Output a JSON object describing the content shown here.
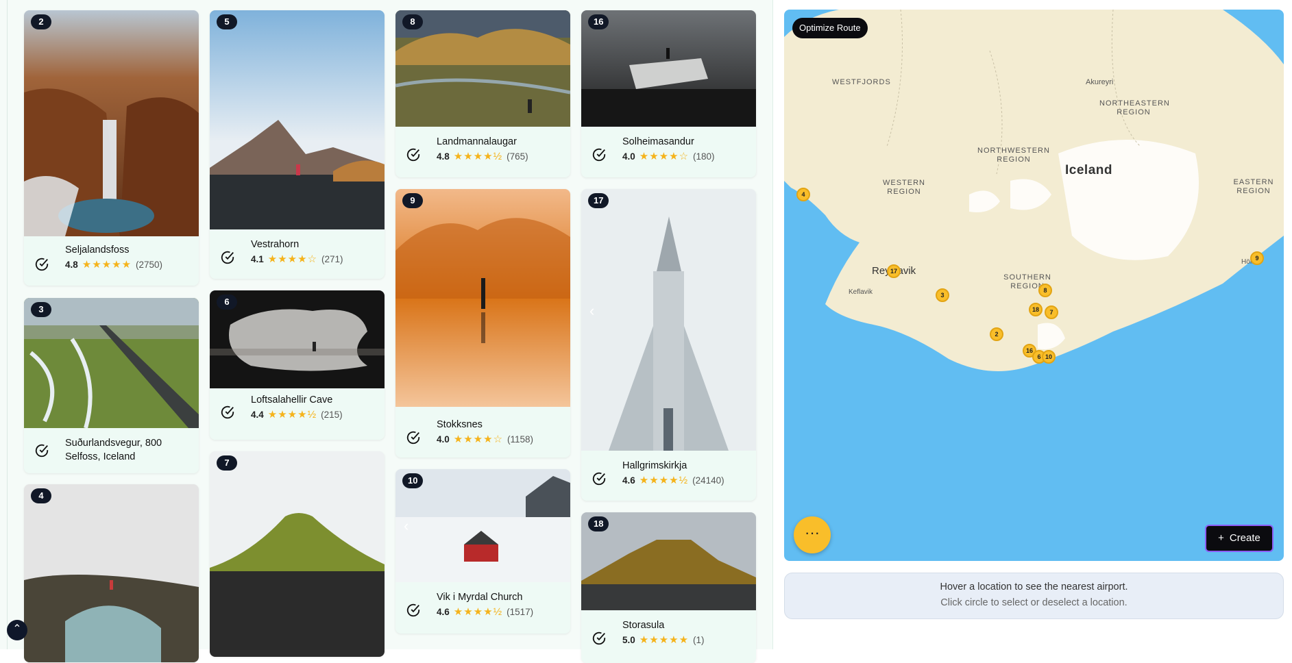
{
  "cards": [
    {
      "num": "2",
      "title": "Seljalandsfoss",
      "rating": "4.8",
      "stars": "★★★★★",
      "count": "(2750)"
    },
    {
      "num": "3",
      "title": "Suðurlandsvegur, 800 Selfoss, Iceland",
      "rating": "",
      "stars": "",
      "count": ""
    },
    {
      "num": "4",
      "title": "",
      "rating": "",
      "stars": "",
      "count": ""
    },
    {
      "num": "5",
      "title": "Vestrahorn",
      "rating": "4.1",
      "stars": "★★★★☆",
      "count": "(271)"
    },
    {
      "num": "6",
      "title": "Loftsalahellir Cave",
      "rating": "4.4",
      "stars": "★★★★½",
      "count": "(215)"
    },
    {
      "num": "7",
      "title": "",
      "rating": "",
      "stars": "",
      "count": ""
    },
    {
      "num": "8",
      "title": "Landmannalaugar",
      "rating": "4.8",
      "stars": "★★★★½",
      "count": "(765)"
    },
    {
      "num": "9",
      "title": "Stokksnes",
      "rating": "4.0",
      "stars": "★★★★☆",
      "count": "(1158)"
    },
    {
      "num": "10",
      "title": "Vik i Myrdal Church",
      "rating": "4.6",
      "stars": "★★★★½",
      "count": "(1517)"
    },
    {
      "num": "16",
      "title": "Solheimasandur",
      "rating": "4.0",
      "stars": "★★★★☆",
      "count": "(180)"
    },
    {
      "num": "17",
      "title": "Hallgrimskirkja",
      "rating": "4.6",
      "stars": "★★★★½",
      "count": "(24140)"
    },
    {
      "num": "18",
      "title": "Storasula",
      "rating": "5.0",
      "stars": "★★★★★",
      "count": "(1)"
    }
  ],
  "map": {
    "optimize_label": "Optimize Route",
    "create_label": "Create",
    "create_icon": "+",
    "dots_label": "···",
    "labels": {
      "westfjords": "WESTFJORDS",
      "akureyri": "Akureyri",
      "northeastern": "NORTHEASTERN REGION",
      "northwestern": "NORTHWESTERN REGION",
      "iceland": "Iceland",
      "western": "WESTERN REGION",
      "eastern": "EASTERN REGION",
      "reykjavik": "Reykjavik",
      "keflavik": "Keflavik",
      "southern": "SOUTHERN REGION",
      "hofn": "Höfn"
    },
    "pins": [
      "4",
      "17",
      "3",
      "8",
      "18",
      "7",
      "2",
      "16",
      "6",
      "10",
      "9"
    ]
  },
  "airport": {
    "line1": "Hover a location to see the nearest airport.",
    "line2": "Click circle to select or deselect a location."
  },
  "colors": {
    "accent": "#f9be2a",
    "dark": "#0b0b0f",
    "water": "#61bdf2",
    "land": "#f3ecd2"
  }
}
